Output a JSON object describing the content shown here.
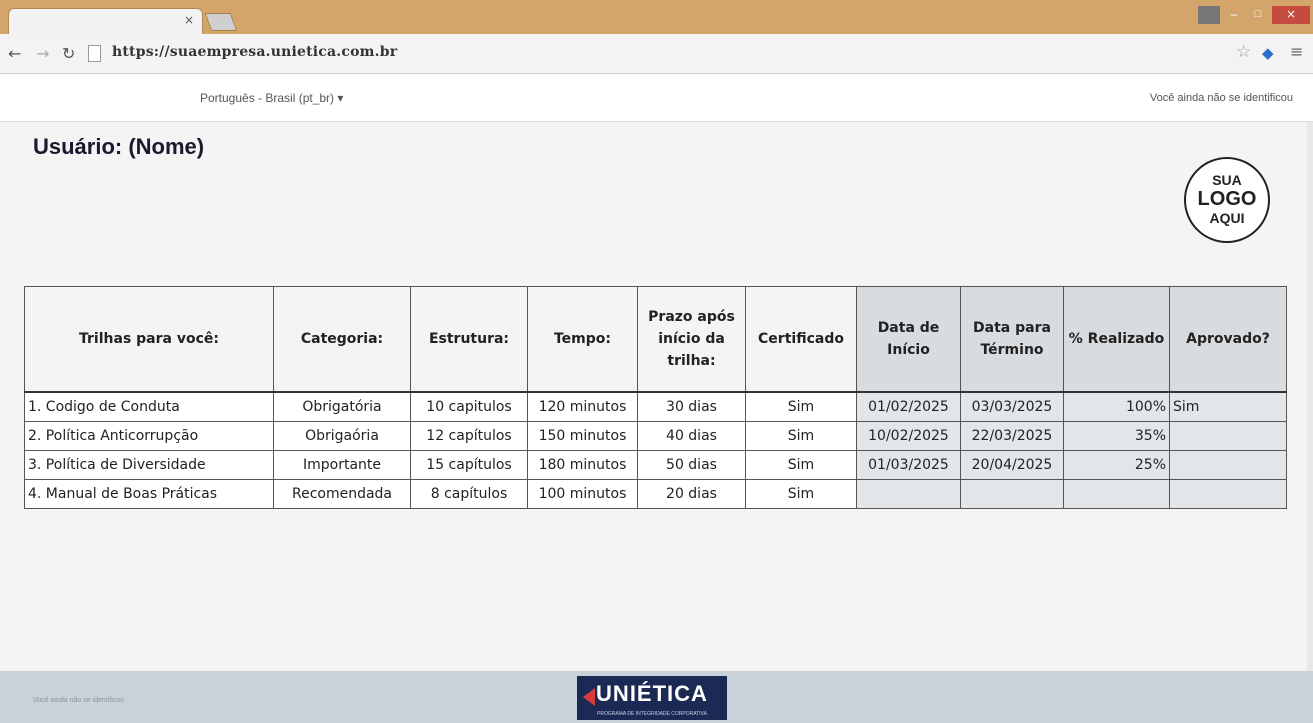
{
  "browser": {
    "tab_close": "×",
    "url": "https://suaempresa.unietica.com.br",
    "close_label": "×",
    "min_label": "–",
    "max_label": "□"
  },
  "header": {
    "language": "Português - Brasil (pt_br) ▾",
    "login_status": "Você ainda não se identificou"
  },
  "page": {
    "title": "Usuário: (Nome)",
    "logo": {
      "line1": "SUA",
      "line2": "LOGO",
      "line3": "AQUI"
    }
  },
  "table": {
    "headers": [
      "Trilhas para você:",
      "Categoria:",
      "Estrutura:",
      "Tempo:",
      "Prazo após início da trilha:",
      "Certificado",
      "Data de Início",
      "Data para Término",
      "% Realizado",
      "Aprovado?"
    ],
    "rows": [
      [
        "1. Codigo de Conduta",
        "Obrigatória",
        "10 capitulos",
        "120 minutos",
        "30 dias",
        "Sim",
        "01/02/2025",
        "03/03/2025",
        "100%",
        "Sim"
      ],
      [
        "2. Política Anticorrupção",
        "Obrigaória",
        "12 capítulos",
        "150 minutos",
        "40 dias",
        "Sim",
        "10/02/2025",
        "22/03/2025",
        "35%",
        ""
      ],
      [
        "3. Política de Diversidade",
        "Importante",
        "15 capítulos",
        "180 minutos",
        "50 dias",
        "Sim",
        "01/03/2025",
        "20/04/2025",
        "25%",
        ""
      ],
      [
        "4. Manual de Boas Práticas",
        "Recomendada",
        "8 capítulos",
        "100 minutos",
        "20 dias",
        "Sim",
        "",
        "",
        "",
        ""
      ]
    ]
  },
  "footer": {
    "text": "Você ainda não se identificou",
    "brand": "UNIÉTICA",
    "brand_sub": "PROGRAMA DE INTEGRIDADE CORPORATIVA"
  },
  "colors": {
    "tabstrip": "#d4a56a",
    "header_shade": "#d8dcdf",
    "footer": "#c9d2d6",
    "brand_bg": "#1b2a55",
    "brand_accent": "#d93a3a"
  }
}
